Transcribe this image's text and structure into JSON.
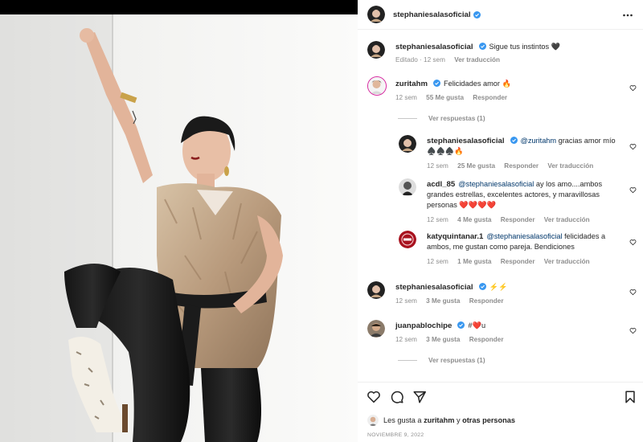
{
  "post": {
    "author": "stephaniesalasoficial",
    "date": "NOVIEMBRE 9, 2022"
  },
  "caption": {
    "username": "stephaniesalasoficial",
    "text": "Sigue tus instintos",
    "emoji": "🖤",
    "edited_time": "Editado · 12 sem",
    "see_translation": "Ver traducción"
  },
  "comments": [
    {
      "username": "zuritahm",
      "verified": true,
      "text": "Felicidades amor",
      "emoji": "🔥",
      "time": "12 sem",
      "likes": "55 Me gusta",
      "reply": "Responder",
      "view_replies": "Ver respuestas (1)",
      "replies": [
        {
          "username": "stephaniesalasoficial",
          "verified": true,
          "mention": "@zuritahm",
          "text": "gracias amor mío",
          "emoji": "♠️♠️♠️🔥",
          "time": "12 sem",
          "likes": "25 Me gusta",
          "reply": "Responder",
          "translate": "Ver traducción"
        },
        {
          "username": "acdl_85",
          "verified": false,
          "mention": "@stephaniesalasoficial",
          "text": "ay los amo....ambos grandes estrellas, excelentes actores, y maravillosas personas",
          "emoji": "❤️❤️❤️❤️",
          "time": "12 sem",
          "likes": "4 Me gusta",
          "reply": "Responder",
          "translate": "Ver traducción"
        },
        {
          "username": "katyquintanar.1",
          "verified": false,
          "mention": "@stephaniesalasoficial",
          "text": "felicidades a ambos, me gustan como pareja. Bendiciones",
          "time": "12 sem",
          "likes": "1 Me gusta",
          "reply": "Responder",
          "translate": "Ver traducción"
        }
      ]
    },
    {
      "username": "stephaniesalasoficial",
      "verified": true,
      "text": "",
      "emoji": "⚡⚡",
      "time": "12 sem",
      "likes": "3 Me gusta",
      "reply": "Responder"
    },
    {
      "username": "juanpablochipe",
      "verified": true,
      "text": "#",
      "emoji": "❤️",
      "text_after": "u",
      "time": "12 sem",
      "likes": "3 Me gusta",
      "reply": "Responder",
      "view_replies": "Ver respuestas (1)"
    }
  ],
  "likes": {
    "prefix": "Les gusta a",
    "user": "zuritahm",
    "connector": "y",
    "others": "otras personas"
  },
  "icons": {
    "more": "more-horizontal-icon",
    "like": "heart-outline-icon",
    "comment": "comment-bubble-icon",
    "share": "paper-plane-icon",
    "save": "bookmark-icon",
    "verified": "verified-badge-icon"
  },
  "colors": {
    "verified": "#3897f0",
    "text": "#262626",
    "muted": "#8e8e8e",
    "link": "#00376b",
    "heart_red": "#ed4956"
  }
}
